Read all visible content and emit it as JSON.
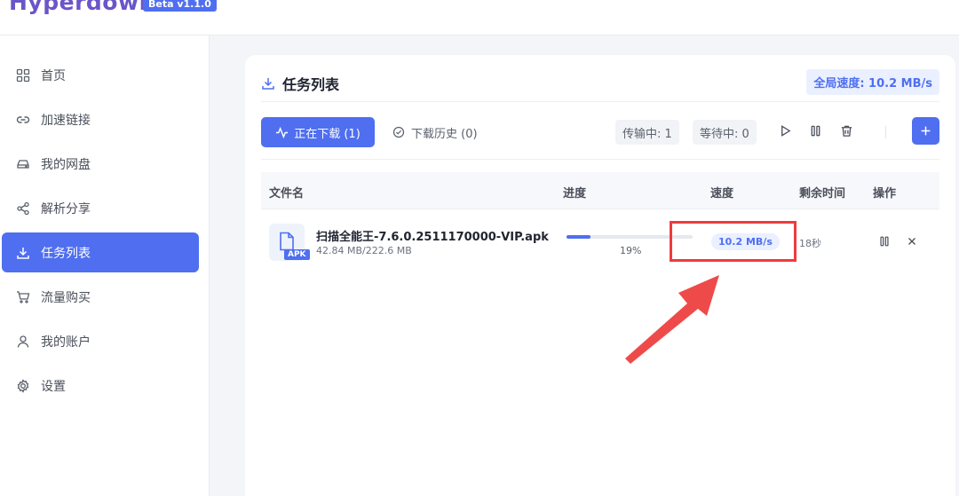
{
  "app": {
    "title": "Hyperdown",
    "badge": "Beta v1.1.0"
  },
  "sidebar": {
    "items": [
      {
        "label": "首页",
        "icon": "grid-icon",
        "active": false
      },
      {
        "label": "加速链接",
        "icon": "link-icon",
        "active": false
      },
      {
        "label": "我的网盘",
        "icon": "drive-icon",
        "active": false
      },
      {
        "label": "解析分享",
        "icon": "share-icon",
        "active": false
      },
      {
        "label": "任务列表",
        "icon": "download-icon",
        "active": true
      },
      {
        "label": "流量购买",
        "icon": "cart-icon",
        "active": false
      },
      {
        "label": "我的账户",
        "icon": "user-icon",
        "active": false
      },
      {
        "label": "设置",
        "icon": "gear-icon",
        "active": false
      }
    ]
  },
  "main": {
    "title": "任务列表",
    "global_speed": "全局速度: 10.2 MB/s",
    "tabs": {
      "downloading": "正在下载 (1)",
      "history": "下载历史 (0)"
    },
    "stats": {
      "transferring": "传输中: 1",
      "waiting": "等待中: 0"
    },
    "table": {
      "headers": {
        "name": "文件名",
        "progress": "进度",
        "speed": "速度",
        "remaining": "剩余时间",
        "actions": "操作"
      },
      "rows": [
        {
          "name": "扫描全能王-7.6.0.2511170000-VIP.apk",
          "size": "42.84 MB/222.6 MB",
          "badge": "APK",
          "progress": 0.19,
          "progress_text": "19%",
          "speed": "10.2 MB/s",
          "remaining": "18秒"
        }
      ]
    }
  },
  "colors": {
    "accent": "#4f6ff0",
    "highlight": "#ef3b3b",
    "brand": "#6a55c9"
  }
}
